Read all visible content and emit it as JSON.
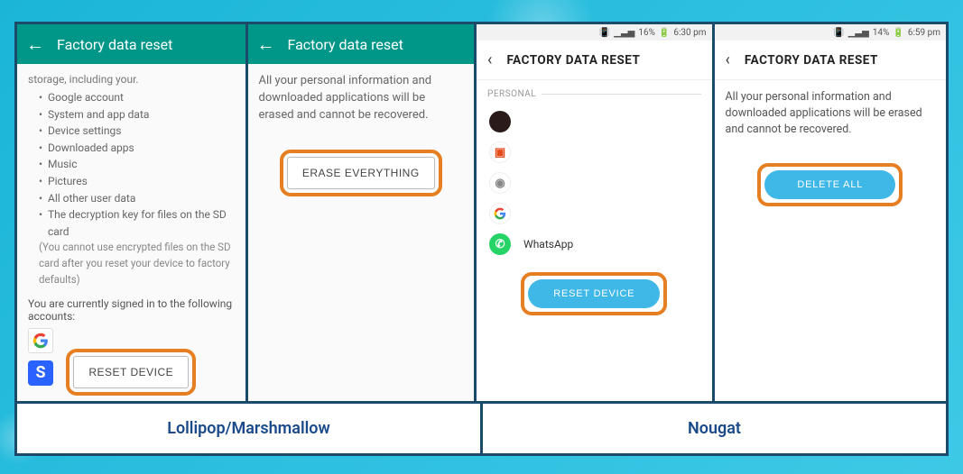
{
  "labels": {
    "left": "Lollipop/Marshmallow",
    "right": "Nougat"
  },
  "pane1": {
    "header_title": "Factory data reset",
    "truncated_line": "storage, including your.",
    "bullets": [
      "Google account",
      "System and app data",
      "Device settings",
      "Downloaded apps",
      "Music",
      "Pictures",
      "All other user data",
      "The decryption key for files on the SD card"
    ],
    "note": "(You cannot use encrypted files on the SD card after you reset your device to factory defaults)",
    "signed_in": "You are currently signed in to the following accounts:",
    "button": "RESET DEVICE"
  },
  "pane2": {
    "header_title": "Factory data reset",
    "message": "All your personal information and downloaded applications will be erased and cannot be recovered.",
    "button": "ERASE EVERYTHING"
  },
  "pane3": {
    "status": {
      "signal_level": "16%",
      "time": "6:30 pm"
    },
    "header_title": "FACTORY DATA RESET",
    "section_label": "PERSONAL",
    "apps": [
      {
        "name": "",
        "icon": "dark-circle"
      },
      {
        "name": "",
        "icon": "office"
      },
      {
        "name": "",
        "icon": "generic"
      },
      {
        "name": "",
        "icon": "google"
      },
      {
        "name": "WhatsApp",
        "icon": "whatsapp"
      }
    ],
    "button": "RESET DEVICE"
  },
  "pane4": {
    "status": {
      "signal_level": "14%",
      "time": "6:59 pm"
    },
    "header_title": "FACTORY DATA RESET",
    "message": "All your personal information and downloaded applications will be erased and cannot be recovered.",
    "button": "DELETE ALL"
  }
}
